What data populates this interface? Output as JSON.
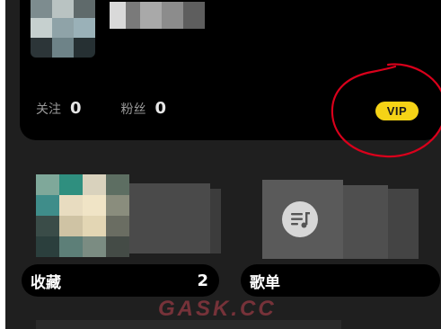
{
  "profile": {
    "follow_label": "关注",
    "follow_count": "0",
    "fans_label": "粉丝",
    "fans_count": "0",
    "vip_label": "VIP"
  },
  "collection": {
    "label": "收藏",
    "count": "2"
  },
  "playlist": {
    "label": "歌单",
    "icon": "playlist-music-icon"
  },
  "annotation": {
    "color": "#d9001b"
  },
  "watermark": "GASK.CC",
  "colors": {
    "background": "#1f1f1f",
    "card": "#000000",
    "vip_badge": "#f5d316"
  }
}
